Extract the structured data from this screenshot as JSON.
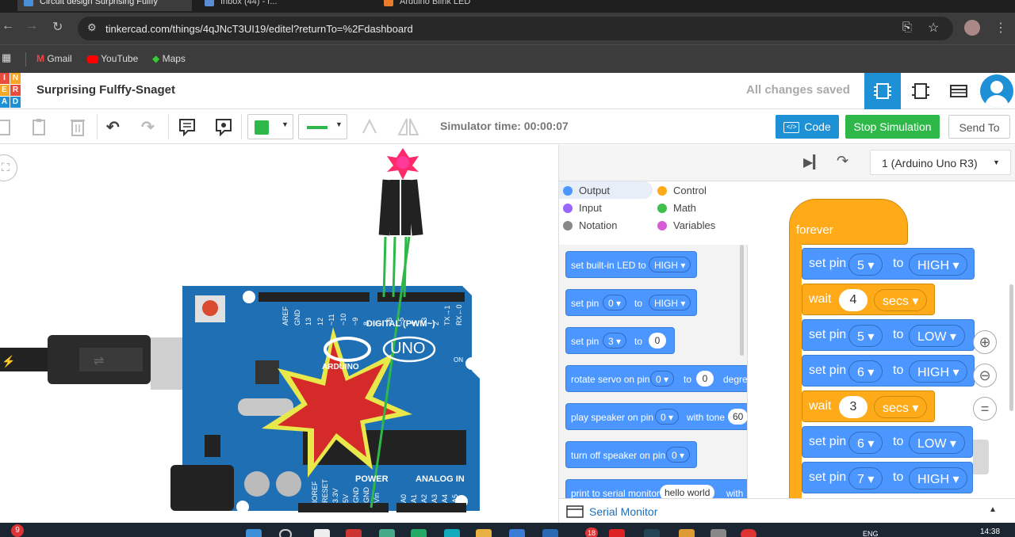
{
  "browser": {
    "tabs": [
      {
        "title": "Circuit design Surprising Fulffy"
      },
      {
        "title": "Inbox (44) - r..."
      },
      {
        "title": "Arduino Blink LED"
      }
    ],
    "url": "tinkercad.com/things/4qJNcT3UI19/editel?returnTo=%2Fdashboard",
    "bookmarks": [
      "Gmail",
      "YouTube",
      "Maps"
    ]
  },
  "app": {
    "logo_letters": [
      "T",
      "I",
      "N",
      "K",
      "E",
      "R",
      "C",
      "A",
      "D"
    ],
    "design_title": "Surprising Fulffy-Snaget",
    "save_status": "All changes saved"
  },
  "editor_toolbar": {
    "simulator_time": "Simulator time: 00:00:07",
    "code_label": "Code",
    "stop_label": "Stop Simulation",
    "send_label": "Send To"
  },
  "board": {
    "name": "UNO",
    "brand": "ARDUINO",
    "digital_label": "DIGITAL (PWM~)",
    "power_label": "POWER",
    "analog_label": "ANALOG IN",
    "on_label": "ON",
    "pin_labels_top": [
      "AREF",
      "GND",
      "13",
      "12",
      "~11",
      "~10",
      "~9",
      "8",
      "7",
      "~6",
      "~5",
      "4",
      "~3",
      "2",
      "TX→1",
      "RX←0"
    ],
    "pin_labels_bottom": [
      "IOREF",
      "RESET",
      "3.3V",
      "5V",
      "GND",
      "GND",
      "Vin",
      "A0",
      "A1",
      "A2",
      "A3",
      "A4",
      "A5"
    ]
  },
  "code_panel": {
    "device_select": "1 (Arduino Uno R3)",
    "categories": [
      {
        "name": "Output",
        "color": "#4c97ff"
      },
      {
        "name": "Control",
        "color": "#ffab19"
      },
      {
        "name": "Input",
        "color": "#9966ff"
      },
      {
        "name": "Math",
        "color": "#40bf4a"
      },
      {
        "name": "Notation",
        "color": "#888888"
      },
      {
        "name": "Variables",
        "color": "#d65cd6"
      }
    ],
    "palette": [
      {
        "text": "set built-in LED to",
        "dd": "HIGH"
      },
      {
        "text": "set pin",
        "dd": "0",
        "to": "to",
        "dd2": "HIGH"
      },
      {
        "text": "set pin",
        "dd": "3",
        "to": "to",
        "num": "0"
      },
      {
        "text": "rotate servo on pin",
        "dd": "0",
        "to": "to",
        "num": "0",
        "tail": "degre"
      },
      {
        "text": "play speaker on pin",
        "dd": "0",
        "to": "with tone",
        "num": "60"
      },
      {
        "text": "turn off speaker on pin",
        "dd": "0"
      },
      {
        "text": "print to serial monitor",
        "num": "hello world",
        "tail": "with"
      }
    ],
    "script": {
      "hat": "forever",
      "blocks": [
        {
          "kind": "set",
          "label": "set pin",
          "pin": "5",
          "to": "to",
          "value": "HIGH"
        },
        {
          "kind": "wait",
          "label": "wait",
          "num": "4",
          "unit": "secs"
        },
        {
          "kind": "set",
          "label": "set pin",
          "pin": "5",
          "to": "to",
          "value": "LOW"
        },
        {
          "kind": "set",
          "label": "set pin",
          "pin": "6",
          "to": "to",
          "value": "HIGH"
        },
        {
          "kind": "wait",
          "label": "wait",
          "num": "3",
          "unit": "secs"
        },
        {
          "kind": "set",
          "label": "set pin",
          "pin": "6",
          "to": "to",
          "value": "LOW"
        },
        {
          "kind": "set",
          "label": "set pin",
          "pin": "7",
          "to": "to",
          "value": "HIGH"
        }
      ]
    },
    "serial_monitor": "Serial Monitor"
  },
  "taskbar": {
    "clock": "14:38",
    "lang": "ENG",
    "badge": "9",
    "badge2": "18"
  }
}
